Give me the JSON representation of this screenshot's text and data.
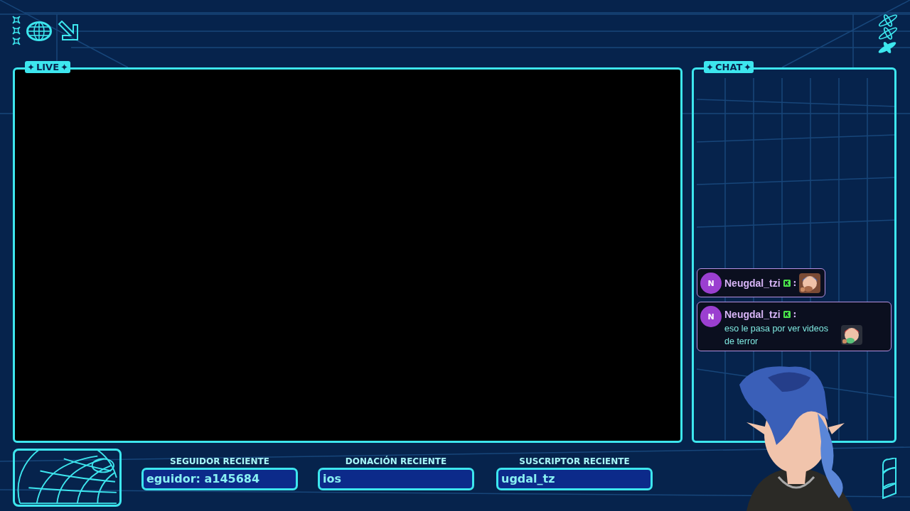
{
  "live": {
    "label": "LIVE"
  },
  "chat": {
    "label": "CHAT",
    "messages": [
      {
        "avatar": "N",
        "user": "Neugdal_tzi",
        "separator": ":"
      },
      {
        "avatar": "N",
        "user": "Neugdal_tzi",
        "separator": ":",
        "text": "eso le pasa por ver videos de terror"
      }
    ]
  },
  "widgets": [
    {
      "label": "SEGUIDOR RECIENTE",
      "value": "eguidor: a145684"
    },
    {
      "label": "DONACIÓN RECIENTE",
      "value": "ios"
    },
    {
      "label": "SUSCRIPTOR RECIENTE",
      "value": "ugdal_tz"
    }
  ]
}
